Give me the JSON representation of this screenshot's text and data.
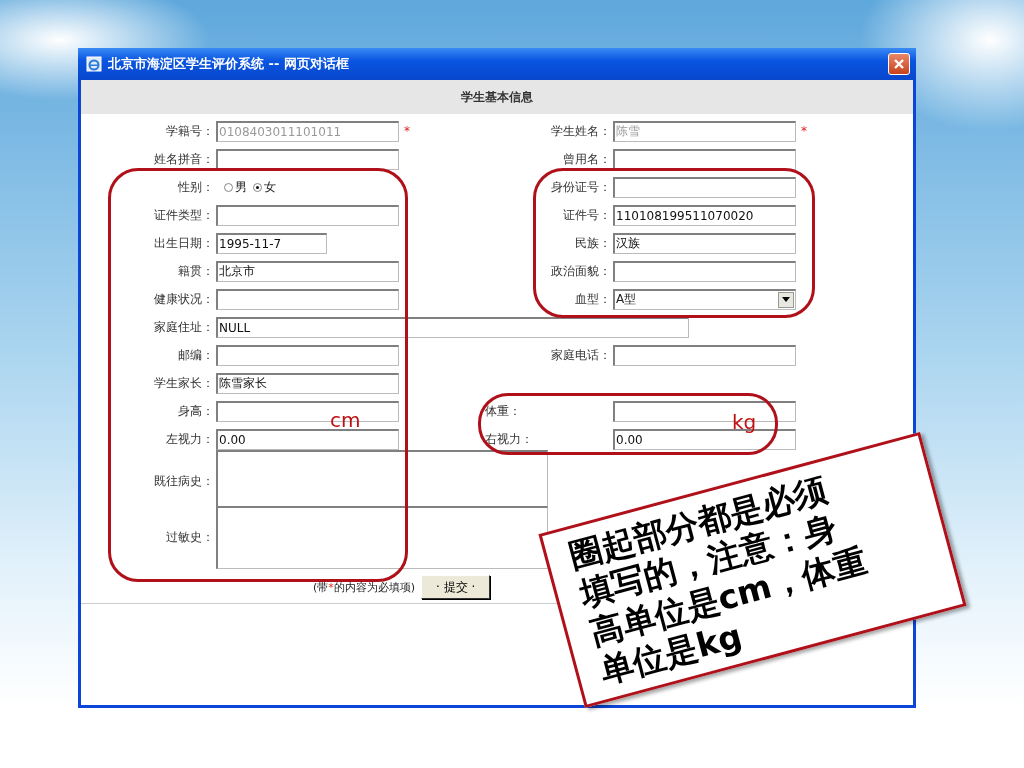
{
  "window": {
    "title": "北京市海淀区学生评价系统 -- 网页对话框"
  },
  "header": "学生基本信息",
  "rows": [
    {
      "left": {
        "kind": "text",
        "label": "学籍号：",
        "value": "0108403011101011",
        "disabled": true,
        "required": "*"
      },
      "right": {
        "kind": "text",
        "label": "学生姓名：",
        "value": "陈雪",
        "disabled": true,
        "required": "*"
      }
    },
    {
      "left": {
        "kind": "text",
        "label": "姓名拼音："
      },
      "right": {
        "kind": "text",
        "label": "曾用名："
      }
    },
    {
      "left": {
        "kind": "radio",
        "label": "性别：",
        "options": [
          {
            "label": "男",
            "selected": false
          },
          {
            "label": "女",
            "selected": true
          }
        ]
      },
      "right": {
        "kind": "text",
        "label": "身份证号："
      }
    },
    {
      "left": {
        "kind": "text",
        "label": "证件类型："
      },
      "right": {
        "kind": "text",
        "label": "证件号：",
        "value": "110108199511070020"
      }
    },
    {
      "left": {
        "kind": "short",
        "label": "出生日期：",
        "value": "1995-11-7"
      },
      "right": {
        "kind": "text",
        "label": "民族：",
        "value": "汉族"
      }
    },
    {
      "left": {
        "kind": "text",
        "label": "籍贯：",
        "value": "北京市"
      },
      "right": {
        "kind": "text",
        "label": "政治面貌："
      }
    },
    {
      "left": {
        "kind": "text",
        "label": "健康状况："
      },
      "right": {
        "kind": "select",
        "label": "血型：",
        "value": "A型"
      }
    },
    {
      "left": {
        "kind": "wide",
        "label": "家庭住址：",
        "value": "NULL"
      }
    },
    {
      "left": {
        "kind": "text",
        "label": "邮编："
      },
      "right": {
        "kind": "text",
        "label": "家庭电话："
      }
    },
    {
      "left": {
        "kind": "text",
        "label": "学生家长：",
        "value": "陈雪家长"
      }
    },
    {
      "left": {
        "kind": "text",
        "label": "身高："
      },
      "right": {
        "kind": "loose",
        "label": "体重："
      }
    },
    {
      "left": {
        "kind": "text",
        "label": "左视力：",
        "value": "0.00"
      },
      "right": {
        "kind": "loose",
        "label": "右视力：",
        "value": "0.00"
      }
    },
    {
      "left": {
        "kind": "textarea",
        "label": "既往病史："
      }
    },
    {
      "left": {
        "kind": "textarea",
        "label": "过敏史："
      }
    }
  ],
  "footnote": {
    "before": "(带",
    "mark": "*",
    "after": "的内容为必填项)"
  },
  "submit_button": "· 提交 ·",
  "annotations": {
    "units": [
      {
        "kind": "height",
        "text": "cm"
      },
      {
        "kind": "weight",
        "text": "kg"
      }
    ],
    "callout": [
      "圈起部分都是必须",
      "填写的，注意：身",
      "高单位是cm，体重",
      "单位是kg"
    ]
  }
}
